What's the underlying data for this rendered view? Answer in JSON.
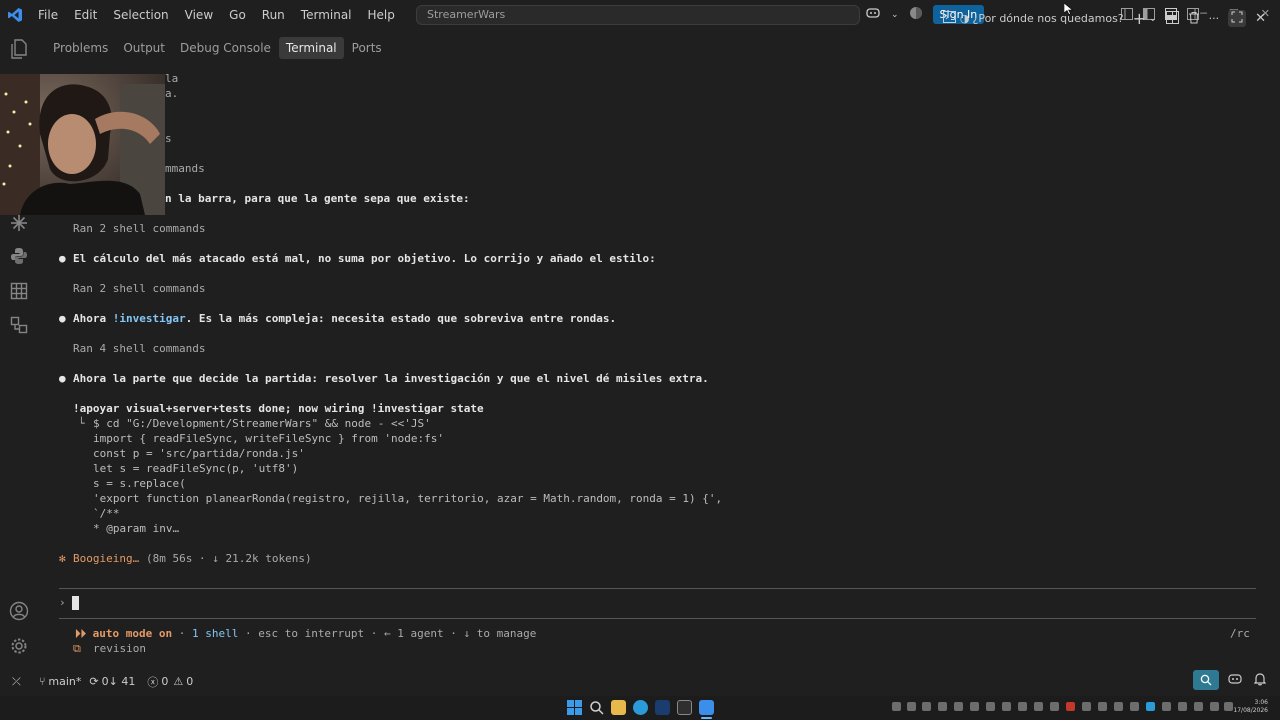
{
  "titlebar": {
    "menu": [
      "File",
      "Edit",
      "Selection",
      "View",
      "Go",
      "Run",
      "Terminal",
      "Help"
    ],
    "search_text": "StreamerWars",
    "sign_in": "Sign In"
  },
  "panel": {
    "tabs": [
      "Problems",
      "Output",
      "Debug Console",
      "Terminal",
      "Ports"
    ],
    "active_tab": "Terminal",
    "terminal_name": "¿Por dónde nos quedamos?"
  },
  "terminal": {
    "fragments": [
      "la",
      "a.",
      "s",
      "mmands",
      "n la barra, para que la gente sepa que existe:"
    ],
    "ran1": "Ran 2 shell commands",
    "msg1": "El cálculo del más atacado está mal, no suma por objetivo. Lo corrijo y añado el estilo:",
    "ran2": "Ran 2 shell commands",
    "msg2_pre": "Ahora ",
    "msg2_cmd": "!investigar",
    "msg2_post": ". Es la más compleja: necesita estado que sobreviva entre rondas.",
    "ran3": "Ran 4 shell commands",
    "msg3": "Ahora la parte que decide la partida: resolver la investigación y que el nivel dé misiles extra.",
    "cmd_title": "!apoyar visual+server+tests done; now wiring !investigar state",
    "code_lines": [
      "$ cd \"G:/Development/StreamerWars\" && node - <<'JS'",
      "import { readFileSync, writeFileSync } from 'node:fs'",
      "const p = 'src/partida/ronda.js'",
      "let s = readFileSync(p, 'utf8')",
      "s = s.replace(",
      "'export function planearRonda(registro, rejilla, territorio, azar = Math.random, ronda = 1) {',",
      "`/**",
      "* @param inv…"
    ],
    "spinner_label": "Boogieing…",
    "spinner_stats": "(8m 56s · ↓ 21.2k tokens)",
    "prompt": "›",
    "mode_arrows": "⏵⏵",
    "mode_label": "auto mode on",
    "mode_shell": "1 shell",
    "mode_rest": " · esc to interrupt · ← 1 agent · ↓ to manage",
    "mode_right": "/rc",
    "revision": "revision"
  },
  "statusbar": {
    "branch": "main*",
    "sync": "0↓ 41",
    "errors": "0",
    "warnings": "0"
  },
  "clock": {
    "time": "3:06",
    "date": "17/08/2026"
  },
  "colors": {
    "accent": "#0e639c",
    "vscode_blue": "#3b8eea",
    "spinner": "#e39a66",
    "cyan": "#86c6f5"
  }
}
